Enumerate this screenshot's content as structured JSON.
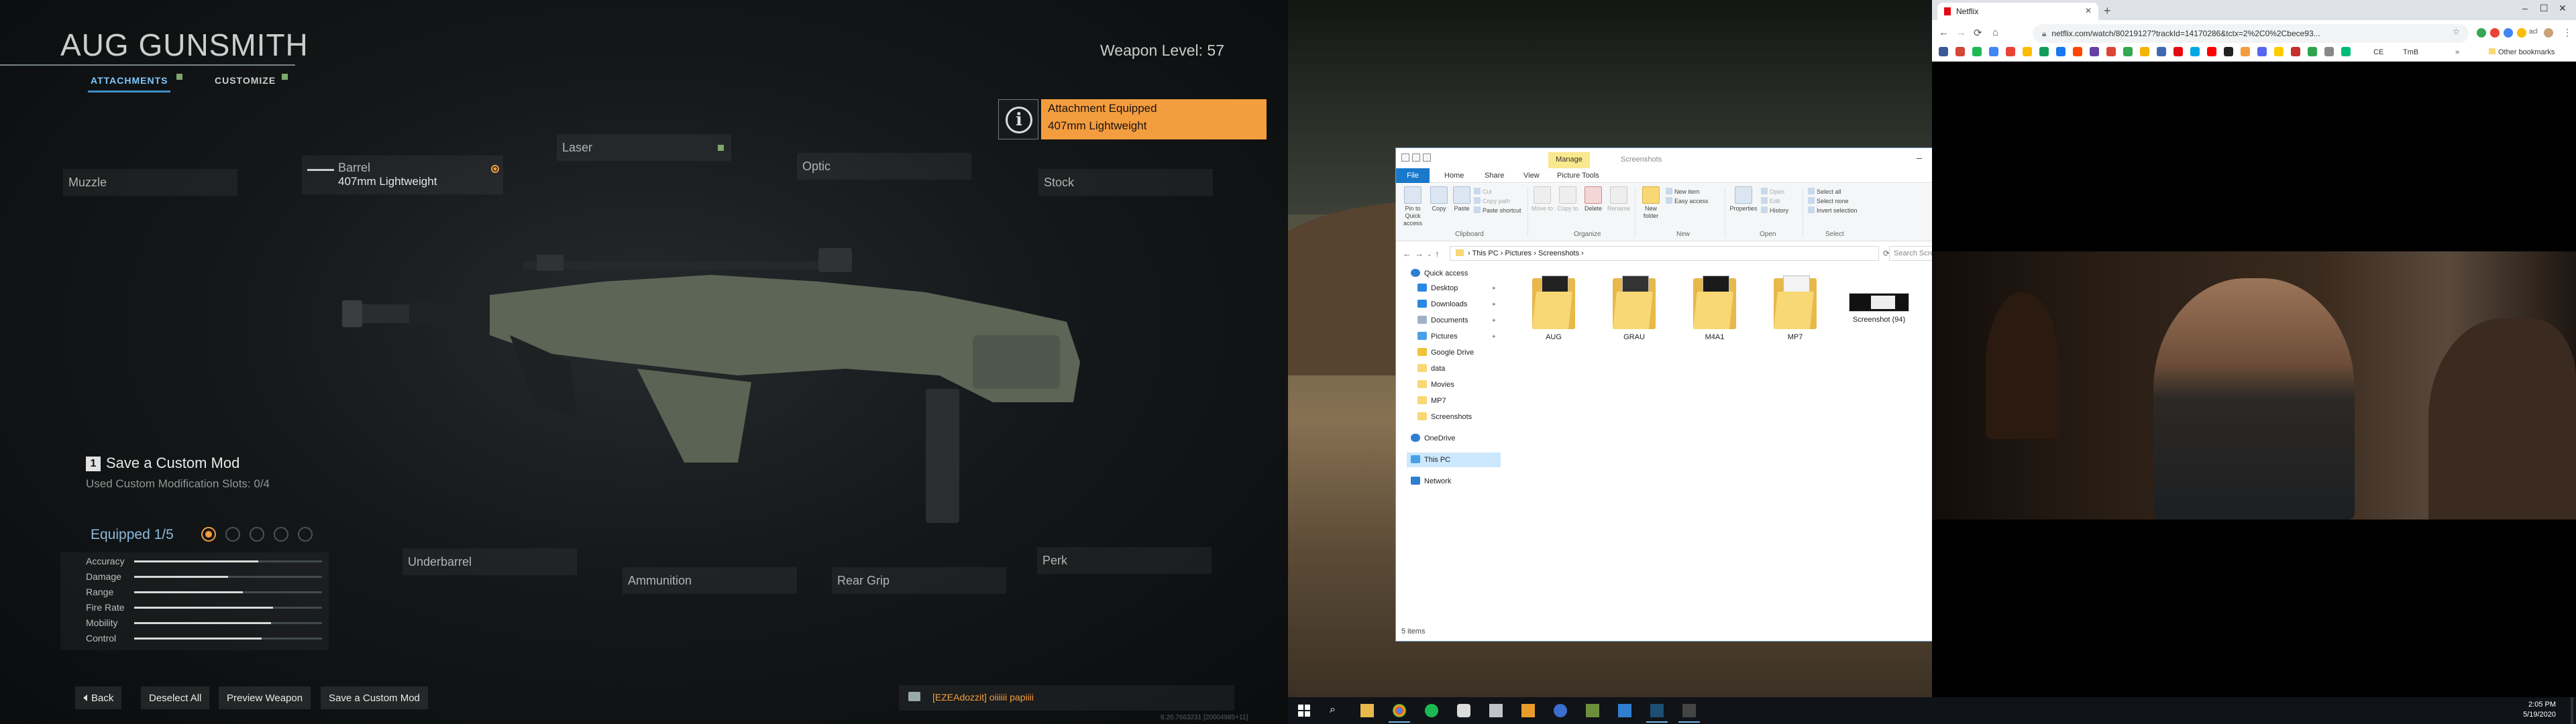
{
  "game": {
    "title": "AUG GUNSMITH",
    "weapon_level": "Weapon Level: 57",
    "tabs": [
      "ATTACHMENTS",
      "CUSTOMIZE"
    ],
    "slots": {
      "muzzle": "Muzzle",
      "barrel": "Barrel",
      "barrel_value": "407mm Lightweight",
      "laser": "Laser",
      "optic": "Optic",
      "stock": "Stock",
      "underbarrel": "Underbarrel",
      "ammunition": "Ammunition",
      "rear_grip": "Rear Grip",
      "perk": "Perk"
    },
    "notice": {
      "title": "Attachment Equipped",
      "value": "407mm Lightweight"
    },
    "save_mod": {
      "key": "1",
      "label": "Save a Custom Mod",
      "used": "Used Custom Modification Slots: 0/4"
    },
    "equipped": {
      "label": "Equipped 1/5",
      "filled": 1,
      "total": 5
    },
    "stats": [
      {
        "label": "Accuracy",
        "value": 0.66
      },
      {
        "label": "Damage",
        "value": 0.5
      },
      {
        "label": "Range",
        "value": 0.58
      },
      {
        "label": "Fire Rate",
        "value": 0.74
      },
      {
        "label": "Mobility",
        "value": 0.73
      },
      {
        "label": "Control",
        "value": 0.68
      }
    ],
    "buttons": [
      "Back",
      "Deselect All",
      "Preview Weapon",
      "Save a Custom Mod"
    ],
    "chat": "[EZEAdozzit] oiiiiii papiiii",
    "build": "8.20.7663231 [20004985+11]"
  },
  "explorer": {
    "contextual_tab": "Manage",
    "window_title": "Screenshots",
    "tabs": [
      "File",
      "Home",
      "Share",
      "View",
      "Picture Tools"
    ],
    "ribbon": {
      "pin": "Pin to Quick access",
      "copy": "Copy",
      "paste": "Paste",
      "cut": "Cut",
      "copy_path": "Copy path",
      "paste_shortcut": "Paste shortcut",
      "move_to": "Move to",
      "copy_to": "Copy to",
      "delete": "Delete",
      "rename": "Rename",
      "new_folder": "New folder",
      "new_item": "New item",
      "easy_access": "Easy access",
      "properties": "Properties",
      "open": "Open",
      "edit": "Edit",
      "history": "History",
      "select_all": "Select all",
      "select_none": "Select none",
      "invert_selection": "Invert selection",
      "groups": [
        "Clipboard",
        "Organize",
        "New",
        "Open",
        "Select"
      ]
    },
    "path": [
      "This PC",
      "Pictures",
      "Screenshots"
    ],
    "search_placeholder": "Search Screenshots",
    "nav": {
      "quick_access": "Quick access",
      "items": [
        "Desktop",
        "Downloads",
        "Documents",
        "Pictures",
        "Google Drive",
        "data",
        "Movies",
        "MP7",
        "Screenshots"
      ],
      "onedrive": "OneDrive",
      "this_pc": "This PC",
      "network": "Network"
    },
    "files": [
      "AUG",
      "GRAU",
      "M4A1",
      "MP7",
      "Screenshot (94)"
    ],
    "status": "5 items"
  },
  "chrome": {
    "tab_title": "Netflix",
    "url": "netflix.com/watch/80219127?trackId=14170286&tctx=2%2C0%2Cbece93...",
    "ext_label": "acl",
    "bookmark_tmb": "TmB",
    "bookmark_ce": "CE",
    "other_bookmarks": "Other bookmarks"
  },
  "taskbar": {
    "time": "2:05 PM",
    "date": "5/19/2020"
  }
}
